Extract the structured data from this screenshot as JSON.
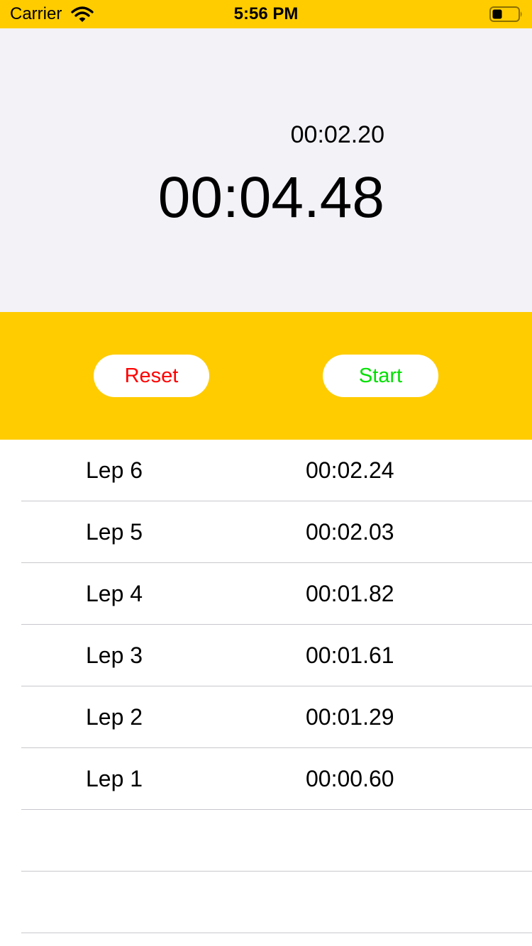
{
  "status_bar": {
    "carrier": "Carrier",
    "time": "5:56 PM",
    "background": "#FFCC00",
    "icons": [
      "wifi-icon",
      "battery-icon"
    ]
  },
  "timer": {
    "lap_time": "00:02.20",
    "main_time": "00:04.48",
    "background": "#F2F2F7"
  },
  "controls": {
    "background": "#FFCC00",
    "reset_label": "Reset",
    "reset_color": "#FF0000",
    "start_label": "Start",
    "start_color": "#00E000"
  },
  "laps": [
    {
      "name": "Lep 6",
      "time": "00:02.24"
    },
    {
      "name": "Lep 5",
      "time": "00:02.03"
    },
    {
      "name": "Lep 4",
      "time": "00:01.82"
    },
    {
      "name": "Lep 3",
      "time": "00:01.61"
    },
    {
      "name": "Lep 2",
      "time": "00:01.29"
    },
    {
      "name": "Lep 1",
      "time": "00:00.60"
    },
    {
      "name": "",
      "time": ""
    },
    {
      "name": "",
      "time": ""
    }
  ]
}
